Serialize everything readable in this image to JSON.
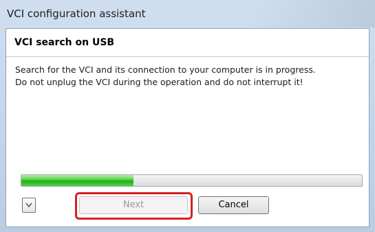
{
  "window": {
    "title": "VCI configuration assistant"
  },
  "section": {
    "title": "VCI search on USB"
  },
  "message": {
    "line1": "Search for the VCI and its connection to your computer is in progress.",
    "line2": "Do not unplug the VCI during the operation and do not interrupt it!"
  },
  "progress": {
    "value_percent": 33,
    "fill_color": "#2fbf25"
  },
  "buttons": {
    "expand_icon": "chevron-down-icon",
    "next_label": "Next",
    "next_enabled": false,
    "cancel_label": "Cancel"
  },
  "annotation": {
    "highlight_color": "#d81e1e",
    "highlighted_element": "next-button"
  }
}
